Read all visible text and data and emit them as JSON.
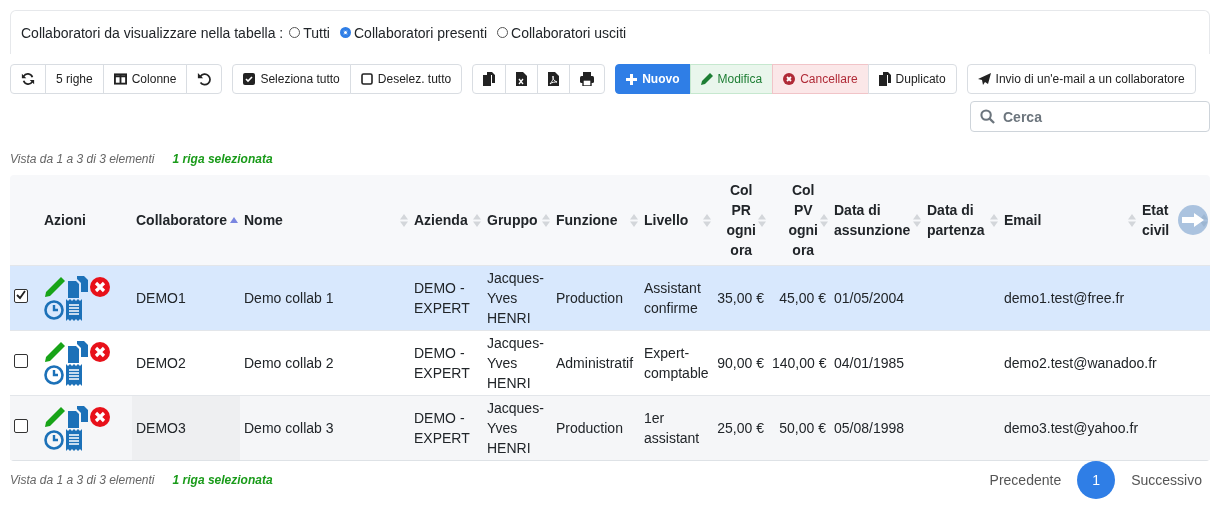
{
  "filter": {
    "label": "Collaboratori da visualizzare nella tabella :",
    "options": [
      {
        "label": "Tutti",
        "selected": false
      },
      {
        "label": "Collaboratori presenti",
        "selected": true
      },
      {
        "label": "Collaboratori usciti",
        "selected": false
      }
    ]
  },
  "toolbar": {
    "view": [
      "5 righe",
      "Colonne"
    ],
    "selection": [
      "Seleziona tutto",
      "Deselez. tutto"
    ],
    "actions": [
      {
        "label": "Nuovo",
        "kind": "primary"
      },
      {
        "label": "Modifica",
        "kind": "success"
      },
      {
        "label": "Cancellare",
        "kind": "danger"
      },
      {
        "label": "Duplicato",
        "kind": "default"
      }
    ],
    "email": "Invio di un'e-mail a un collaboratore"
  },
  "search": {
    "placeholder": "Cerca"
  },
  "info_top": {
    "text": "Vista da 1 a 3 di 3 elementi",
    "selection": "1 riga selezionata"
  },
  "table": {
    "columns": [
      {
        "label": "Azioni"
      },
      {
        "label": "Collaboratore",
        "sorted": true
      },
      {
        "label": "Nome",
        "sorted": false
      },
      {
        "label": "Azienda",
        "sorted": false
      },
      {
        "label": "Gruppo",
        "sorted": false
      },
      {
        "label": "Funzione",
        "sorted": false
      },
      {
        "label": "Livello",
        "sorted": false
      },
      {
        "label": "Col PR ogni ora",
        "sorted": false
      },
      {
        "label": "Col PV ogni ora",
        "sorted": false
      },
      {
        "label": "Data di assunzione",
        "sorted": false
      },
      {
        "label": "Data di partenza",
        "sorted": false
      },
      {
        "label": "Email",
        "sorted": false
      },
      {
        "label": "Etat civil",
        "sorted": false
      }
    ],
    "rows": [
      {
        "selected": true,
        "cells": [
          "",
          "DEMO1",
          "Demo collab 1",
          "DEMO - EXPERT",
          "Jacques-Yves HENRI",
          "Production",
          "Assistant confirme",
          "35,00 €",
          "45,00 €",
          "01/05/2004",
          "",
          "demo1.test@free.fr",
          ""
        ]
      },
      {
        "selected": false,
        "cells": [
          "",
          "DEMO2",
          "Demo collab 2",
          "DEMO - EXPERT",
          "Jacques-Yves HENRI",
          "Administratif",
          "Expert-comptable",
          "90,00 €",
          "140,00 €",
          "04/01/1985",
          "",
          "demo2.test@wanadoo.fr",
          ""
        ]
      },
      {
        "selected": false,
        "cells": [
          "",
          "DEMO3",
          "Demo collab 3",
          "DEMO - EXPERT",
          "Jacques-Yves HENRI",
          "Production",
          "1er assistant",
          "25,00 €",
          "50,00 €",
          "05/08/1998",
          "",
          "demo3.test@yahoo.fr",
          ""
        ]
      }
    ]
  },
  "info_bottom": {
    "text": "Vista da 1 a 3 di 3 elementi",
    "selection": "1 riga selezionata"
  },
  "pagination": {
    "previous": "Precedente",
    "pages": [
      {
        "label": "1",
        "selected": true
      }
    ],
    "next": "Successivo"
  }
}
